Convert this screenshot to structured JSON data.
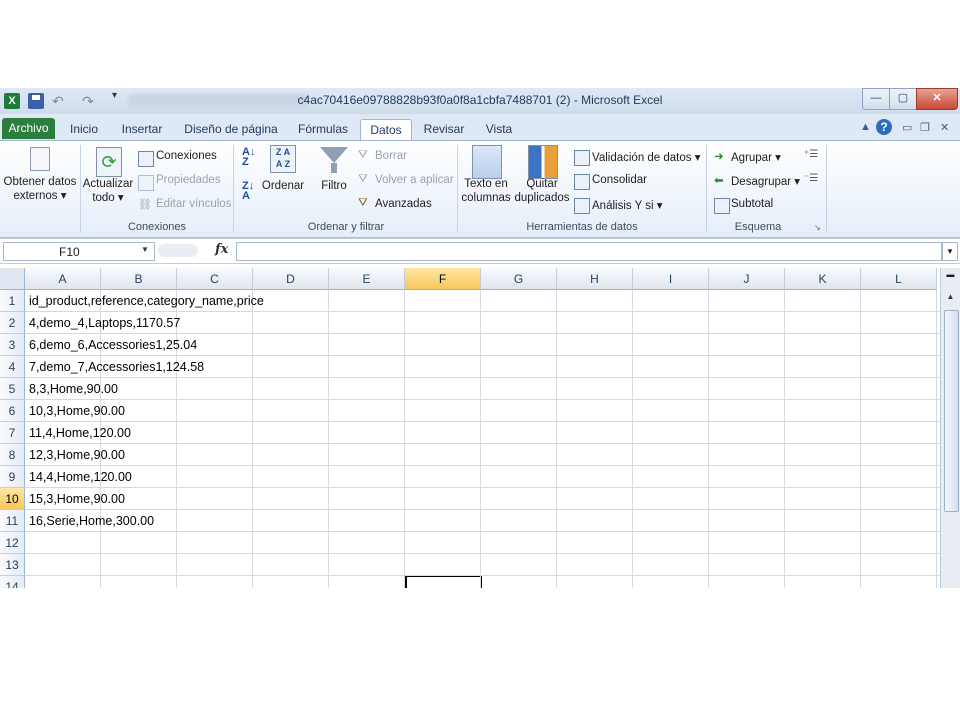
{
  "window": {
    "title": "c4ac70416e09788828b93f0a0f8a1cbfa7488701 (2)  -  Microsoft Excel",
    "logo": "X",
    "controls": {
      "minimize": "—",
      "maximize": "▢",
      "close": "✕"
    }
  },
  "tabs": [
    {
      "label": "Archivo"
    },
    {
      "label": "Inicio"
    },
    {
      "label": "Insertar"
    },
    {
      "label": "Diseño de página"
    },
    {
      "label": "Fórmulas"
    },
    {
      "label": "Datos"
    },
    {
      "label": "Revisar"
    },
    {
      "label": "Vista"
    }
  ],
  "active_tab": "Datos",
  "ribbon": {
    "groups": {
      "external": {
        "button": "Obtener datos",
        "button2": "externos ▾"
      },
      "connections": {
        "label": "Conexiones",
        "refresh": "Actualizar",
        "refresh2": "todo ▾",
        "connections": "Conexiones",
        "properties": "Propiedades",
        "edit_links": "Editar vínculos"
      },
      "sort_filter": {
        "label": "Ordenar y filtrar",
        "sort": "Ordenar",
        "filter": "Filtro",
        "clear": "Borrar",
        "reapply": "Volver a aplicar",
        "advanced": "Avanzadas"
      },
      "data_tools": {
        "label": "Herramientas de datos",
        "text_to_columns": "Texto en",
        "text_to_columns2": "columnas",
        "remove_duplicates": "Quitar",
        "remove_duplicates2": "duplicados",
        "validation": "Validación de datos ▾",
        "consolidate": "Consolidar",
        "what_if": "Análisis Y si ▾"
      },
      "outline": {
        "label": "Esquema",
        "group": "Agrupar ▾",
        "ungroup": "Desagrupar ▾",
        "subtotal": "Subtotal"
      }
    }
  },
  "formula_bar": {
    "name_box": "F10",
    "fx": "fx",
    "value": ""
  },
  "sheet": {
    "columns": [
      "A",
      "B",
      "C",
      "D",
      "E",
      "F",
      "G",
      "H",
      "I",
      "J",
      "K",
      "L"
    ],
    "selected_column": "F",
    "rows": [
      "1",
      "2",
      "3",
      "4",
      "5",
      "6",
      "7",
      "8",
      "9",
      "10",
      "11",
      "12",
      "13",
      "14"
    ],
    "selected_row": "10",
    "cells_a": [
      "id_product,reference,category_name,price",
      "4,demo_4,Laptops,1170.57",
      "6,demo_6,Accessories1,25.04",
      "7,demo_7,Accessories1,124.58",
      "8,3,Home,90.00",
      "10,3,Home,90.00",
      "11,4,Home,120.00",
      "12,3,Home,90.00",
      "14,4,Home,120.00",
      "15,3,Home,90.00",
      "16,Serie,Home,300.00"
    ]
  }
}
